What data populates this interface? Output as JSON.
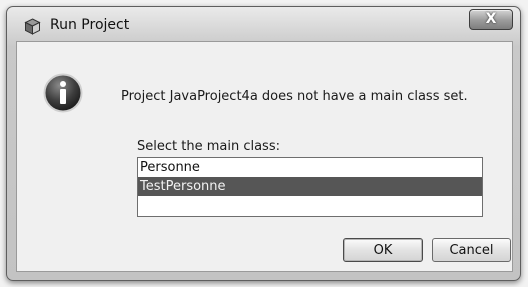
{
  "window": {
    "title": "Run Project",
    "close_glyph": "X"
  },
  "dialog": {
    "message": "Project JavaProject4a does not have a main class set.",
    "list_label": "Select the main class:",
    "classes": [
      "Personne",
      "TestPersonne"
    ],
    "selected_index": 1,
    "ok_label": "OK",
    "cancel_label": "Cancel"
  },
  "icons": {
    "app": "netbeans-cube-icon",
    "info": "info-icon",
    "close": "close-icon"
  }
}
